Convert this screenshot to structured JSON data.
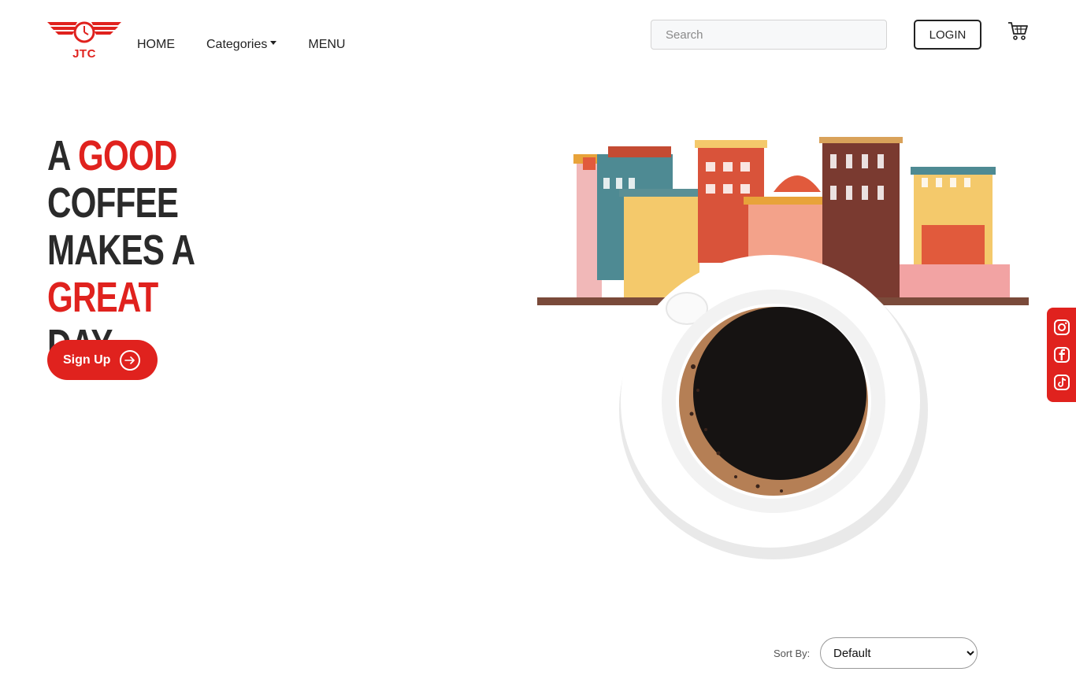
{
  "brand": {
    "logo_text": "JTC",
    "accent": "#e0221e"
  },
  "nav": {
    "home": "HOME",
    "categories": "Categories",
    "menu": "MENU"
  },
  "search": {
    "placeholder": "Search"
  },
  "login": {
    "label": "LOGIN"
  },
  "cart": {
    "icon": "cart-icon"
  },
  "hero": {
    "line1_a": "A ",
    "line1_b": "GOOD",
    "line1_c": " COFFEE",
    "line2_a": "MAKES A ",
    "line2_b": "GREAT",
    "line3": "DAY",
    "cta": "Sign Up"
  },
  "social": {
    "icons": [
      "instagram-icon",
      "facebook-icon",
      "tiktok-icon"
    ]
  },
  "sort": {
    "label": "Sort By:",
    "selected": "Default"
  }
}
